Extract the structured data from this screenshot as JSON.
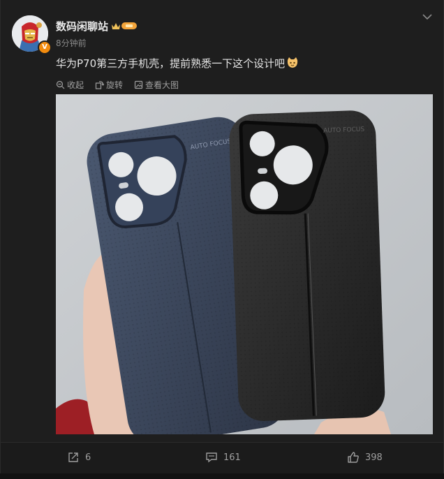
{
  "post": {
    "username": "数码闲聊站",
    "verified_badge": "V",
    "time": "8分钟前",
    "text": "华为P70第三方手机壳，提前熟悉一下这个设计吧",
    "emoji_icon": "cat-face-icon",
    "photo_alt": "two phone cases",
    "case_brand_text": "AUTO FOCUS"
  },
  "tools": {
    "collect_label": "收起",
    "rotate_label": "旋转",
    "view_large_label": "查看大图"
  },
  "footer": {
    "share_count": "6",
    "comment_count": "161",
    "like_count": "398"
  },
  "colors": {
    "background": "#1e1e1e",
    "text": "#e6e6e6",
    "muted": "#8a8a8a",
    "accent": "#f28b0e"
  }
}
